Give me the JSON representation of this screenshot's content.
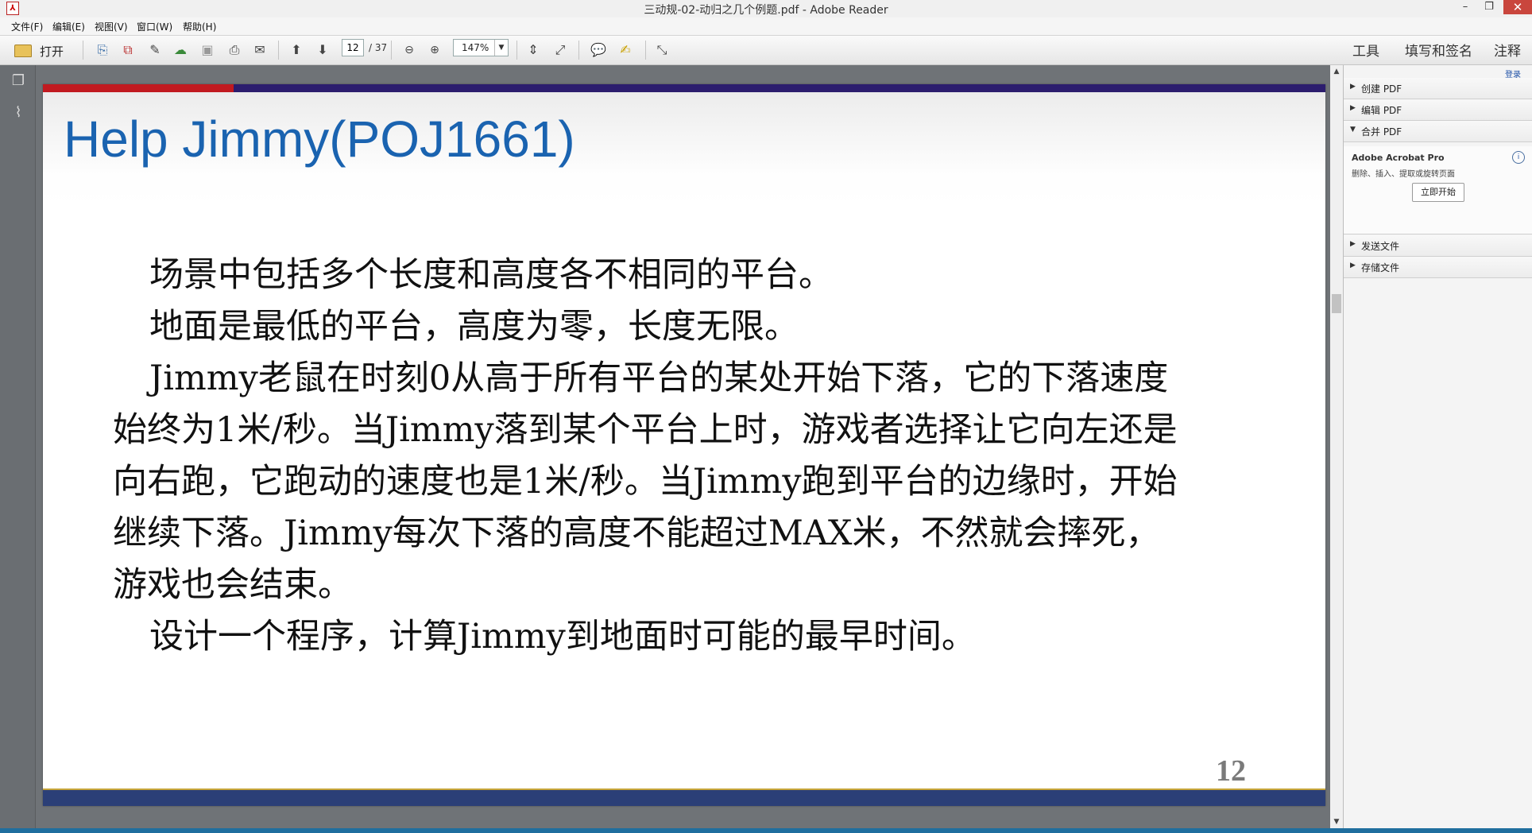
{
  "window": {
    "title": "三动规-02-动归之几个例题.pdf - Adobe Reader",
    "app_icon": "pdf-icon",
    "controls": [
      "minimize-icon",
      "restore-icon",
      "close-icon"
    ]
  },
  "menu": {
    "items": [
      "文件(F)",
      "编辑(E)",
      "视图(V)",
      "窗口(W)",
      "帮助(H)"
    ]
  },
  "toolbar": {
    "open_label": "打开",
    "page_current": "12",
    "page_total": "/ 37",
    "zoom": "147%",
    "tools_link": "工具",
    "fill_sign_link": "填写和签名",
    "comment_link": "注释"
  },
  "slide": {
    "title": "Help Jimmy(POJ1661)",
    "paragraphs": [
      "场景中包括多个长度和高度各不相同的平台。",
      "地面是最低的平台，高度为零，长度无限。",
      "Jimmy老鼠在时刻0从高于所有平台的某处开始下落，它的下落速度始终为1米/秒。当Jimmy落到某个平台上时，游戏者选择让它向左还是向右跑，它跑动的速度也是1米/秒。当Jimmy跑到平台的边缘时，开始继续下落。Jimmy每次下落的高度不能超过MAX米，不然就会摔死，游戏也会结束。",
      "设计一个程序，计算Jimmy到地面时可能的最早时间。"
    ],
    "page_number": "12",
    "colors": {
      "title": "#1a63b0",
      "bar_red": "#c11a20",
      "bar_blue": "#2c1d6e",
      "bottom_bar": "#2b3f77"
    }
  },
  "right_panel": {
    "login": "登录",
    "sections": {
      "create": "创建 PDF",
      "edit": "编辑 PDF",
      "combine": "合并 PDF",
      "send": "发送文件",
      "store": "存储文件"
    },
    "promo": {
      "title": "Adobe Acrobat Pro",
      "desc": "删除、插入、提取或旋转页面",
      "button": "立即开始"
    }
  }
}
